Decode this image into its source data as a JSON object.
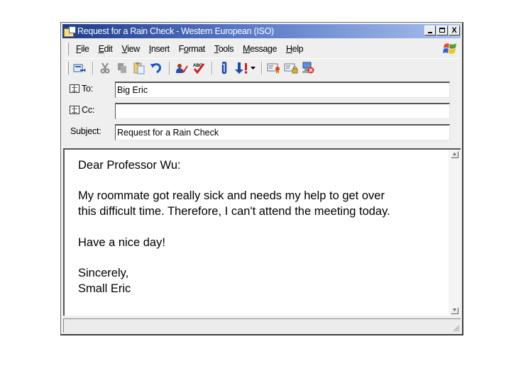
{
  "window": {
    "title": "Request for a Rain Check - Western European (ISO)",
    "buttons": {
      "minimize": "_",
      "maximize": "□",
      "close": "X"
    }
  },
  "menu": {
    "items": [
      {
        "label": "File",
        "accel": "F",
        "rest": "ile"
      },
      {
        "label": "Edit",
        "accel": "E",
        "rest": "dit"
      },
      {
        "label": "View",
        "accel": "V",
        "rest": "iew"
      },
      {
        "label": "Insert",
        "accel": "I",
        "rest": "nsert"
      },
      {
        "label": "Format",
        "pre": "F",
        "accel": "o",
        "rest": "rmat"
      },
      {
        "label": "Tools",
        "accel": "T",
        "rest": "ools"
      },
      {
        "label": "Message",
        "accel": "M",
        "rest": "essage"
      },
      {
        "label": "Help",
        "accel": "H",
        "rest": "elp"
      }
    ]
  },
  "toolbar": {
    "icons": [
      "send",
      "cut",
      "copy",
      "paste",
      "undo",
      "check-names",
      "spelling",
      "attach",
      "priority",
      "sign",
      "encrypt",
      "work-offline"
    ]
  },
  "fields": {
    "to_label": "To:",
    "to_value": "Big Eric",
    "cc_label": "Cc:",
    "cc_value": "",
    "subject_label": "Subject:",
    "subject_value": "Request for a Rain Check"
  },
  "body": {
    "text": "Dear Professor Wu:\n\nMy roommate got really sick and needs my help to get over\nthis difficult time. Therefore, I can't attend the meeting today.\n\nHave a nice day!\n\nSincerely,\nSmall Eric"
  },
  "status": {
    "text": ""
  }
}
